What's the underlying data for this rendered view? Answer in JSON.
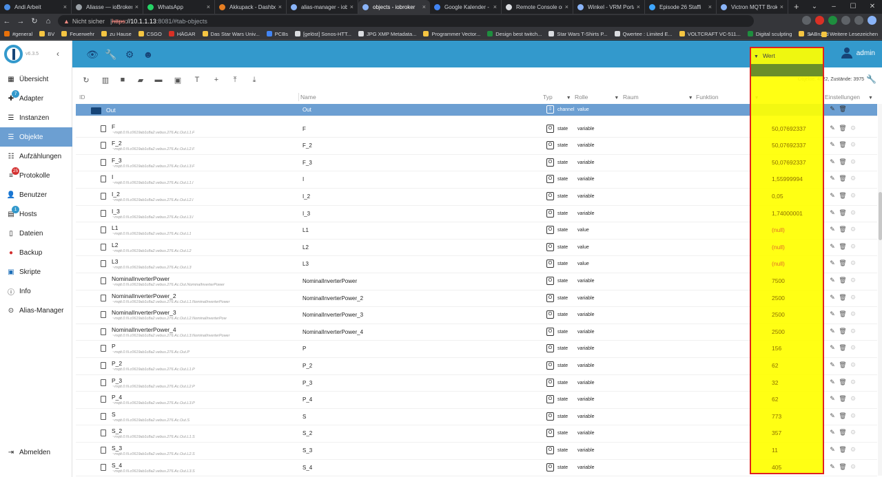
{
  "browser": {
    "tabs": [
      {
        "label": "Andi Arbeit",
        "color": "#4a8ee6",
        "active": false
      },
      {
        "label": "Aliasse — ioBroker C",
        "color": "#9aa0a6",
        "active": false
      },
      {
        "label": "WhatsApp",
        "color": "#25d366",
        "active": false
      },
      {
        "label": "Akkupack - Dashboa",
        "color": "#e67e22",
        "active": false
      },
      {
        "label": "alias-manager - iob",
        "color": "#8ab4f8",
        "active": false
      },
      {
        "label": "objects - iobroker",
        "color": "#8ab4f8",
        "active": true
      },
      {
        "label": "Google Kalender - W",
        "color": "#4285f4",
        "active": false
      },
      {
        "label": "Remote Console on",
        "color": "#dadce0",
        "active": false
      },
      {
        "label": "Winkel - VRM Portal",
        "color": "#8ab4f8",
        "active": false
      },
      {
        "label": "Episode 26 Staffi",
        "color": "#3ea6ff",
        "active": false
      },
      {
        "label": "Victron MQTT Broke",
        "color": "#8ab4f8",
        "active": false
      }
    ],
    "new_tab": "+",
    "address": {
      "warning": "▲",
      "insecure": "Nicht sicher",
      "sep": " | ",
      "scheme": "https",
      "host": "://10.1.1.13",
      "path": ":8081/#tab-objects"
    },
    "bookmarks": [
      "#general",
      "BV",
      "Feuerwehr",
      "zu Hause",
      "CSGO",
      "HÄGAR",
      "Das Star Wars Univ...",
      "PCBs",
      "[gelöst] Sonos-HTT...",
      "JPG XMP Metadata...",
      "Programmer Vector...",
      "Design best twitch...",
      "Star Wars T-Shirts P...",
      "Qwertee : Limited E...",
      "VOLTCRAFT VC-511...",
      "Digital sculpting",
      "SABnzbd"
    ],
    "bookmarks_more": "»",
    "bookmarks_other": "Weitere Lesezeichen"
  },
  "sidebar": {
    "version": "v6.3.5",
    "collapse": "‹",
    "items": [
      {
        "label": "Übersicht",
        "icon": "grid-icon",
        "badge": ""
      },
      {
        "label": "Adapter",
        "icon": "puzzle-icon",
        "badge": "7"
      },
      {
        "label": "Instanzen",
        "icon": "list-icon",
        "badge": ""
      },
      {
        "label": "Objekte",
        "icon": "list-icon",
        "badge": ""
      },
      {
        "label": "Aufzählungen",
        "icon": "enum-icon",
        "badge": ""
      },
      {
        "label": "Protokolle",
        "icon": "log-icon",
        "badge": "25"
      },
      {
        "label": "Benutzer",
        "icon": "user-icon",
        "badge": ""
      },
      {
        "label": "Hosts",
        "icon": "host-icon",
        "badge": "1"
      },
      {
        "label": "Dateien",
        "icon": "file-icon",
        "badge": ""
      },
      {
        "label": "Backup",
        "icon": "backup-icon",
        "badge": ""
      },
      {
        "label": "Skripte",
        "icon": "script-icon",
        "badge": ""
      },
      {
        "label": "Info",
        "icon": "info-icon",
        "badge": ""
      },
      {
        "label": "Alias-Manager",
        "icon": "alias-icon",
        "badge": ""
      }
    ],
    "logout": "Abmelden"
  },
  "topbar": {
    "user": "admin"
  },
  "toolbar": {
    "object_count": "Objekte: 4922, Zustände: 3975"
  },
  "columns": {
    "id": "ID",
    "name": "Name",
    "type": "Typ",
    "role": "Rolle",
    "room": "Raum",
    "function": "Funktion",
    "value": "Wert",
    "settings": "Einstellungen"
  },
  "rows": [
    {
      "id": "Out",
      "sub": "",
      "name": "Out",
      "type_icon": "⇩",
      "type": "channel",
      "role": "value",
      "value": "",
      "channel": true
    },
    {
      "id": "F",
      "sub": "~mqtt.0.N.c0619ab1c8a2.vebus.276.Ac.Out.L1.F",
      "name": "F",
      "type_icon": "O",
      "type": "state",
      "role": "variable",
      "value": "50,07692337"
    },
    {
      "id": "F_2",
      "sub": "~mqtt.0.N.c0619ab1c8a2.vebus.276.Ac.Out.L2.F",
      "name": "F_2",
      "type_icon": "O",
      "type": "state",
      "role": "variable",
      "value": "50,07692337"
    },
    {
      "id": "F_3",
      "sub": "~mqtt.0.N.c0619ab1c8a2.vebus.276.Ac.Out.L3.F",
      "name": "F_3",
      "type_icon": "O",
      "type": "state",
      "role": "variable",
      "value": "50,07692337"
    },
    {
      "id": "I",
      "sub": "~mqtt.0.N.c0619ab1c8a2.vebus.276.Ac.Out.L1.I",
      "name": "I",
      "type_icon": "O",
      "type": "state",
      "role": "variable",
      "value": "1,55999994"
    },
    {
      "id": "I_2",
      "sub": "~mqtt.0.N.c0619ab1c8a2.vebus.276.Ac.Out.L2.I",
      "name": "I_2",
      "type_icon": "O",
      "type": "state",
      "role": "variable",
      "value": "0,05"
    },
    {
      "id": "I_3",
      "sub": "~mqtt.0.N.c0619ab1c8a2.vebus.276.Ac.Out.L3.I",
      "name": "I_3",
      "type_icon": "O",
      "type": "state",
      "role": "variable",
      "value": "1,74000001"
    },
    {
      "id": "L1",
      "sub": "~mqtt.0.N.c0619ab1c8a2.vebus.276.Ac.Out.L1",
      "name": "L1",
      "type_icon": "O",
      "type": "state",
      "role": "value",
      "value": "(null)",
      "null": true
    },
    {
      "id": "L2",
      "sub": "~mqtt.0.N.c0619ab1c8a2.vebus.276.Ac.Out.L2",
      "name": "L2",
      "type_icon": "O",
      "type": "state",
      "role": "value",
      "value": "(null)",
      "null": true
    },
    {
      "id": "L3",
      "sub": "~mqtt.0.N.c0619ab1c8a2.vebus.276.Ac.Out.L3",
      "name": "L3",
      "type_icon": "O",
      "type": "state",
      "role": "value",
      "value": "(null)",
      "null": true
    },
    {
      "id": "NominalInverterPower",
      "sub": "~mqtt.0.N.c0619ab1c8a2.vebus.276.Ac.Out.NominalInverterPower",
      "name": "NominalInverterPower",
      "type_icon": "O",
      "type": "state",
      "role": "variable",
      "value": "7500"
    },
    {
      "id": "NominalInverterPower_2",
      "sub": "~mqtt.0.N.c0619ab1c8a2.vebus.276.Ac.Out.L1.NominalInverterPower",
      "name": "NominalInverterPower_2",
      "type_icon": "O",
      "type": "state",
      "role": "variable",
      "value": "2500"
    },
    {
      "id": "NominalInverterPower_3",
      "sub": "~mqtt.0.N.c0619ab1c8a2.vebus.276.Ac.Out.L2.NominalInverterPow",
      "name": "NominalInverterPower_3",
      "type_icon": "O",
      "type": "state",
      "role": "variable",
      "value": "2500"
    },
    {
      "id": "NominalInverterPower_4",
      "sub": "~mqtt.0.N.c0619ab1c8a2.vebus.276.Ac.Out.L3.NominalInverterPower",
      "name": "NominalInverterPower_4",
      "type_icon": "O",
      "type": "state",
      "role": "variable",
      "value": "2500"
    },
    {
      "id": "P",
      "sub": "~mqtt.0.N.c0619ab1c8a2.vebus.276.Ac.Out.P",
      "name": "P",
      "type_icon": "O",
      "type": "state",
      "role": "variable",
      "value": "156"
    },
    {
      "id": "P_2",
      "sub": "~mqtt.0.N.c0619ab1c8a2.vebus.276.Ac.Out.L1.P",
      "name": "P_2",
      "type_icon": "O",
      "type": "state",
      "role": "variable",
      "value": "62"
    },
    {
      "id": "P_3",
      "sub": "~mqtt.0.N.c0619ab1c8a2.vebus.276.Ac.Out.L2.P",
      "name": "P_3",
      "type_icon": "O",
      "type": "state",
      "role": "variable",
      "value": "32"
    },
    {
      "id": "P_4",
      "sub": "~mqtt.0.N.c0619ab1c8a2.vebus.276.Ac.Out.L3.P",
      "name": "P_4",
      "type_icon": "O",
      "type": "state",
      "role": "variable",
      "value": "62"
    },
    {
      "id": "S",
      "sub": "~mqtt.0.N.c0619ab1c8a2.vebus.276.Ac.Out.S",
      "name": "S",
      "type_icon": "O",
      "type": "state",
      "role": "variable",
      "value": "773"
    },
    {
      "id": "S_2",
      "sub": "~mqtt.0.N.c0619ab1c8a2.vebus.276.Ac.Out.L1.S",
      "name": "S_2",
      "type_icon": "O",
      "type": "state",
      "role": "variable",
      "value": "357"
    },
    {
      "id": "S_3",
      "sub": "~mqtt.0.N.c0619ab1c8a2.vebus.276.Ac.Out.L2.S",
      "name": "S_3",
      "type_icon": "O",
      "type": "state",
      "role": "variable",
      "value": "11"
    },
    {
      "id": "S_4",
      "sub": "~mqtt.0.N.c0619ab1c8a2.vebus.276.Ac.Out.L3.S",
      "name": "S_4",
      "type_icon": "O",
      "type": "state",
      "role": "variable",
      "value": "405"
    }
  ],
  "colors": {
    "primary": "#3399cc",
    "dark": "#164477",
    "selected_row": "#6c9fd2",
    "highlight": "#ffff00",
    "highlight_border": "#e02020"
  }
}
